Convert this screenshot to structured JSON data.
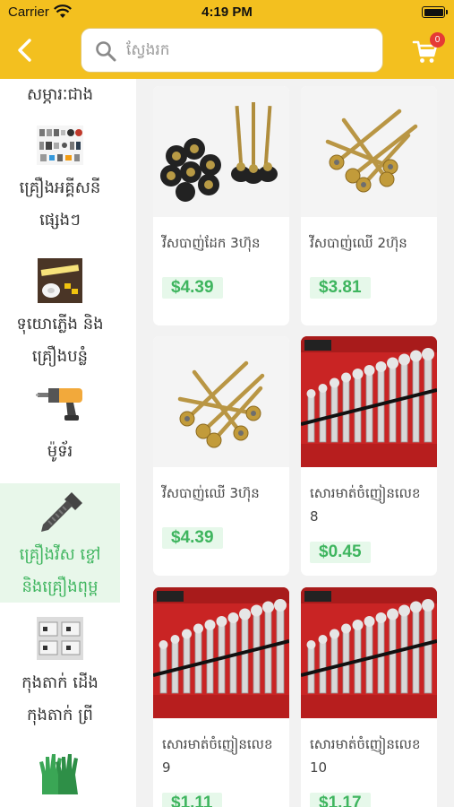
{
  "status_bar": {
    "carrier": "Carrier",
    "time": "4:19 PM"
  },
  "header": {
    "cart_count": "0"
  },
  "search": {
    "placeholder": "ស្វែងរក"
  },
  "sidebar": {
    "items": [
      {
        "label_lines": [
          "សម្ភារៈជាង"
        ],
        "icon": "building-materials-icon"
      },
      {
        "label_lines": [
          "គ្រឿងអគ្គីសនី",
          "ផ្សេងៗ"
        ],
        "icon": "electrical-parts-icon"
      },
      {
        "label_lines": [
          "ទុយោភ្លើង និង",
          "គ្រឿងបន្លំ"
        ],
        "icon": "conduit-pipe-icon"
      },
      {
        "label_lines": [
          "ម៉ូទ័រ"
        ],
        "icon": "drill-motor-icon"
      },
      {
        "label_lines": [
          "គ្រឿងវីស ខ្ចៅ",
          "និងគ្រឿងពុម្ព"
        ],
        "icon": "screw-bolt-icon",
        "active": true
      },
      {
        "label_lines": [
          "កុងតាក់ ដើង",
          "កុងតាក់ ព្រី"
        ],
        "icon": "switch-socket-icon"
      },
      {
        "label_lines": [
          ""
        ],
        "icon": "work-gloves-icon"
      }
    ]
  },
  "products": [
    {
      "name_lines": [
        "វីសបាញ់ដែក 3ហ៊ុន"
      ],
      "price": "$4.39",
      "image": "screws-rubber-washer"
    },
    {
      "name_lines": [
        "វីសបាញ់ឈើ 2ហ៊ុន"
      ],
      "price": "$3.81",
      "image": "hex-screws-gold"
    },
    {
      "name_lines": [
        "វីសបាញ់ឈើ 3ហ៊ុន"
      ],
      "price": "$4.39",
      "image": "hex-screws-gold-long"
    },
    {
      "name_lines": [
        "សោរមាត់ចំញៀនលេខ",
        "8"
      ],
      "price": "$0.45",
      "image": "wrench-set-red"
    },
    {
      "name_lines": [
        "សោរមាត់ចំញៀនលេខ",
        "9"
      ],
      "price": "$1.11",
      "image": "wrench-set-red"
    },
    {
      "name_lines": [
        "សោរមាត់ចំញៀនលេខ",
        "10"
      ],
      "price": "$1.17",
      "image": "wrench-set-red"
    }
  ],
  "colors": {
    "header": "#f3c01f",
    "accent_green": "#3fb55f",
    "price_bg": "#e6f8ea",
    "badge": "#e53935"
  }
}
